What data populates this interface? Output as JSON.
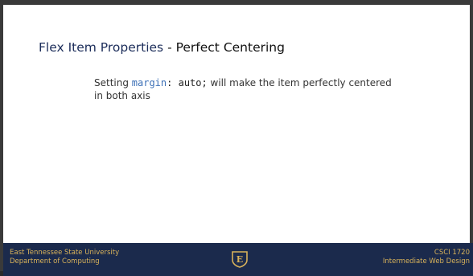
{
  "slide": {
    "title_accent": "Flex Item Properties",
    "title_separator": " - ",
    "title_rest": "Perfect Centering",
    "body": {
      "prefix": "Setting ",
      "keyword": "margin",
      "code": ": auto;",
      "suffix": " will make the item perfectly centered in both axis"
    }
  },
  "footer": {
    "left_line1": "East Tennessee State University",
    "left_line2": "Department of Computing",
    "right_line1": "CSCI 1720",
    "right_line2": "Intermediate Web Design",
    "logo_letter": "E"
  },
  "colors": {
    "footer_bg": "#1b2a4c",
    "footer_text": "#d8b25a",
    "keyword": "#3b6fb6"
  }
}
